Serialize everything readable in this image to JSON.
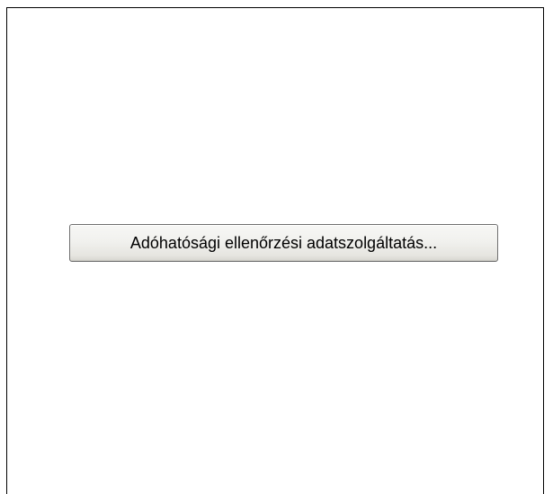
{
  "main": {
    "tax_audit_button_label": "Adóhatósági ellenőrzési adatszolgáltatás..."
  }
}
